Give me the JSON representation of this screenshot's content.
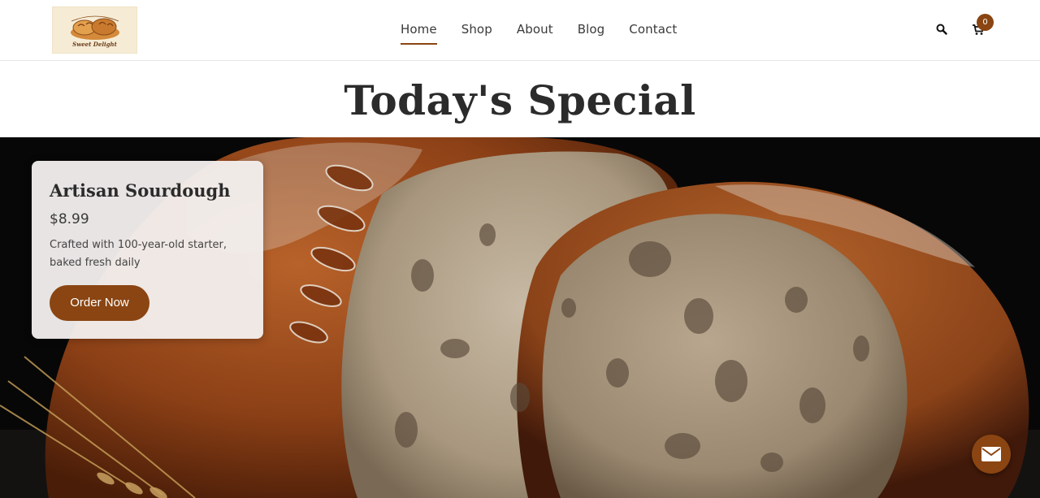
{
  "brand": {
    "logo_text": "Sweet Delight",
    "accent_color": "#8a4512"
  },
  "nav": {
    "items": [
      {
        "label": "Home",
        "active": true
      },
      {
        "label": "Shop",
        "active": false
      },
      {
        "label": "About",
        "active": false
      },
      {
        "label": "Blog",
        "active": false
      },
      {
        "label": "Contact",
        "active": false
      }
    ]
  },
  "header_actions": {
    "search_icon": "search-icon",
    "cart_icon": "cart-icon",
    "cart_count": "0"
  },
  "special": {
    "title": "Today's Special"
  },
  "product": {
    "name": "Artisan Sourdough",
    "price": "$8.99",
    "description": "Crafted with 100-year-old starter, baked fresh daily",
    "order_label": "Order Now"
  },
  "floating": {
    "mail_icon": "envelope-icon"
  }
}
